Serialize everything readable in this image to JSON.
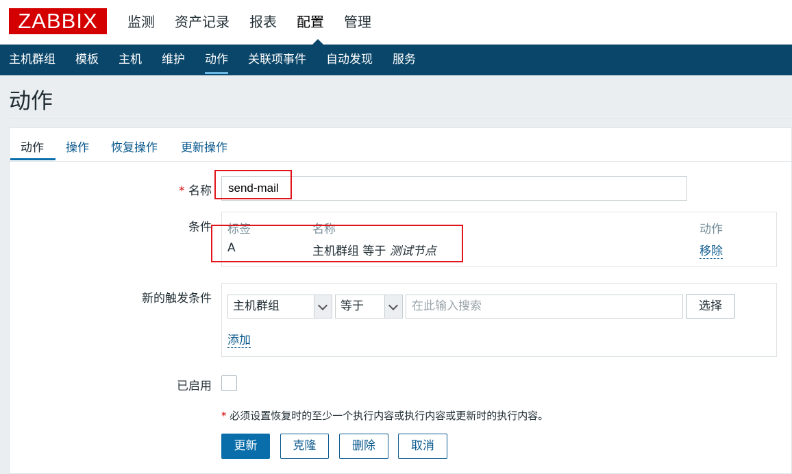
{
  "app": {
    "logo": "ZABBIX",
    "brand_color": "#d40000"
  },
  "main_menu": [
    {
      "label": "监测",
      "active": false
    },
    {
      "label": "资产记录",
      "active": false
    },
    {
      "label": "报表",
      "active": false
    },
    {
      "label": "配置",
      "active": true
    },
    {
      "label": "管理",
      "active": false
    }
  ],
  "sub_menu": [
    {
      "label": "主机群组",
      "active": false
    },
    {
      "label": "模板",
      "active": false
    },
    {
      "label": "主机",
      "active": false
    },
    {
      "label": "维护",
      "active": false
    },
    {
      "label": "动作",
      "active": true
    },
    {
      "label": "关联项事件",
      "active": false
    },
    {
      "label": "自动发现",
      "active": false
    },
    {
      "label": "服务",
      "active": false
    }
  ],
  "page": {
    "title": "动作"
  },
  "tabs": [
    {
      "label": "动作",
      "active": true
    },
    {
      "label": "操作",
      "active": false
    },
    {
      "label": "恢复操作",
      "active": false
    },
    {
      "label": "更新操作",
      "active": false
    }
  ],
  "form": {
    "name": {
      "required_mark": "*",
      "label": "名称",
      "value": "send-mail"
    },
    "conditions": {
      "label": "条件",
      "headers": {
        "tag": "标签",
        "name": "名称",
        "action": "动作"
      },
      "rows": [
        {
          "tag": "A",
          "name_prefix": "主机群组 等于 ",
          "name_value": "测试节点",
          "action": "移除"
        }
      ]
    },
    "new_trigger": {
      "label": "新的触发条件",
      "type_select": "主机群组",
      "operator_select": "等于",
      "search_placeholder": "在此输入搜索",
      "select_button": "选择",
      "add_link": "添加"
    },
    "enabled": {
      "label": "已启用",
      "checked": false
    },
    "note": {
      "mark": "*",
      "text": "必须设置恢复时的至少一个执行内容或执行内容或更新时的执行内容。"
    },
    "buttons": {
      "update": "更新",
      "clone": "克隆",
      "delete": "删除",
      "cancel": "取消"
    }
  }
}
